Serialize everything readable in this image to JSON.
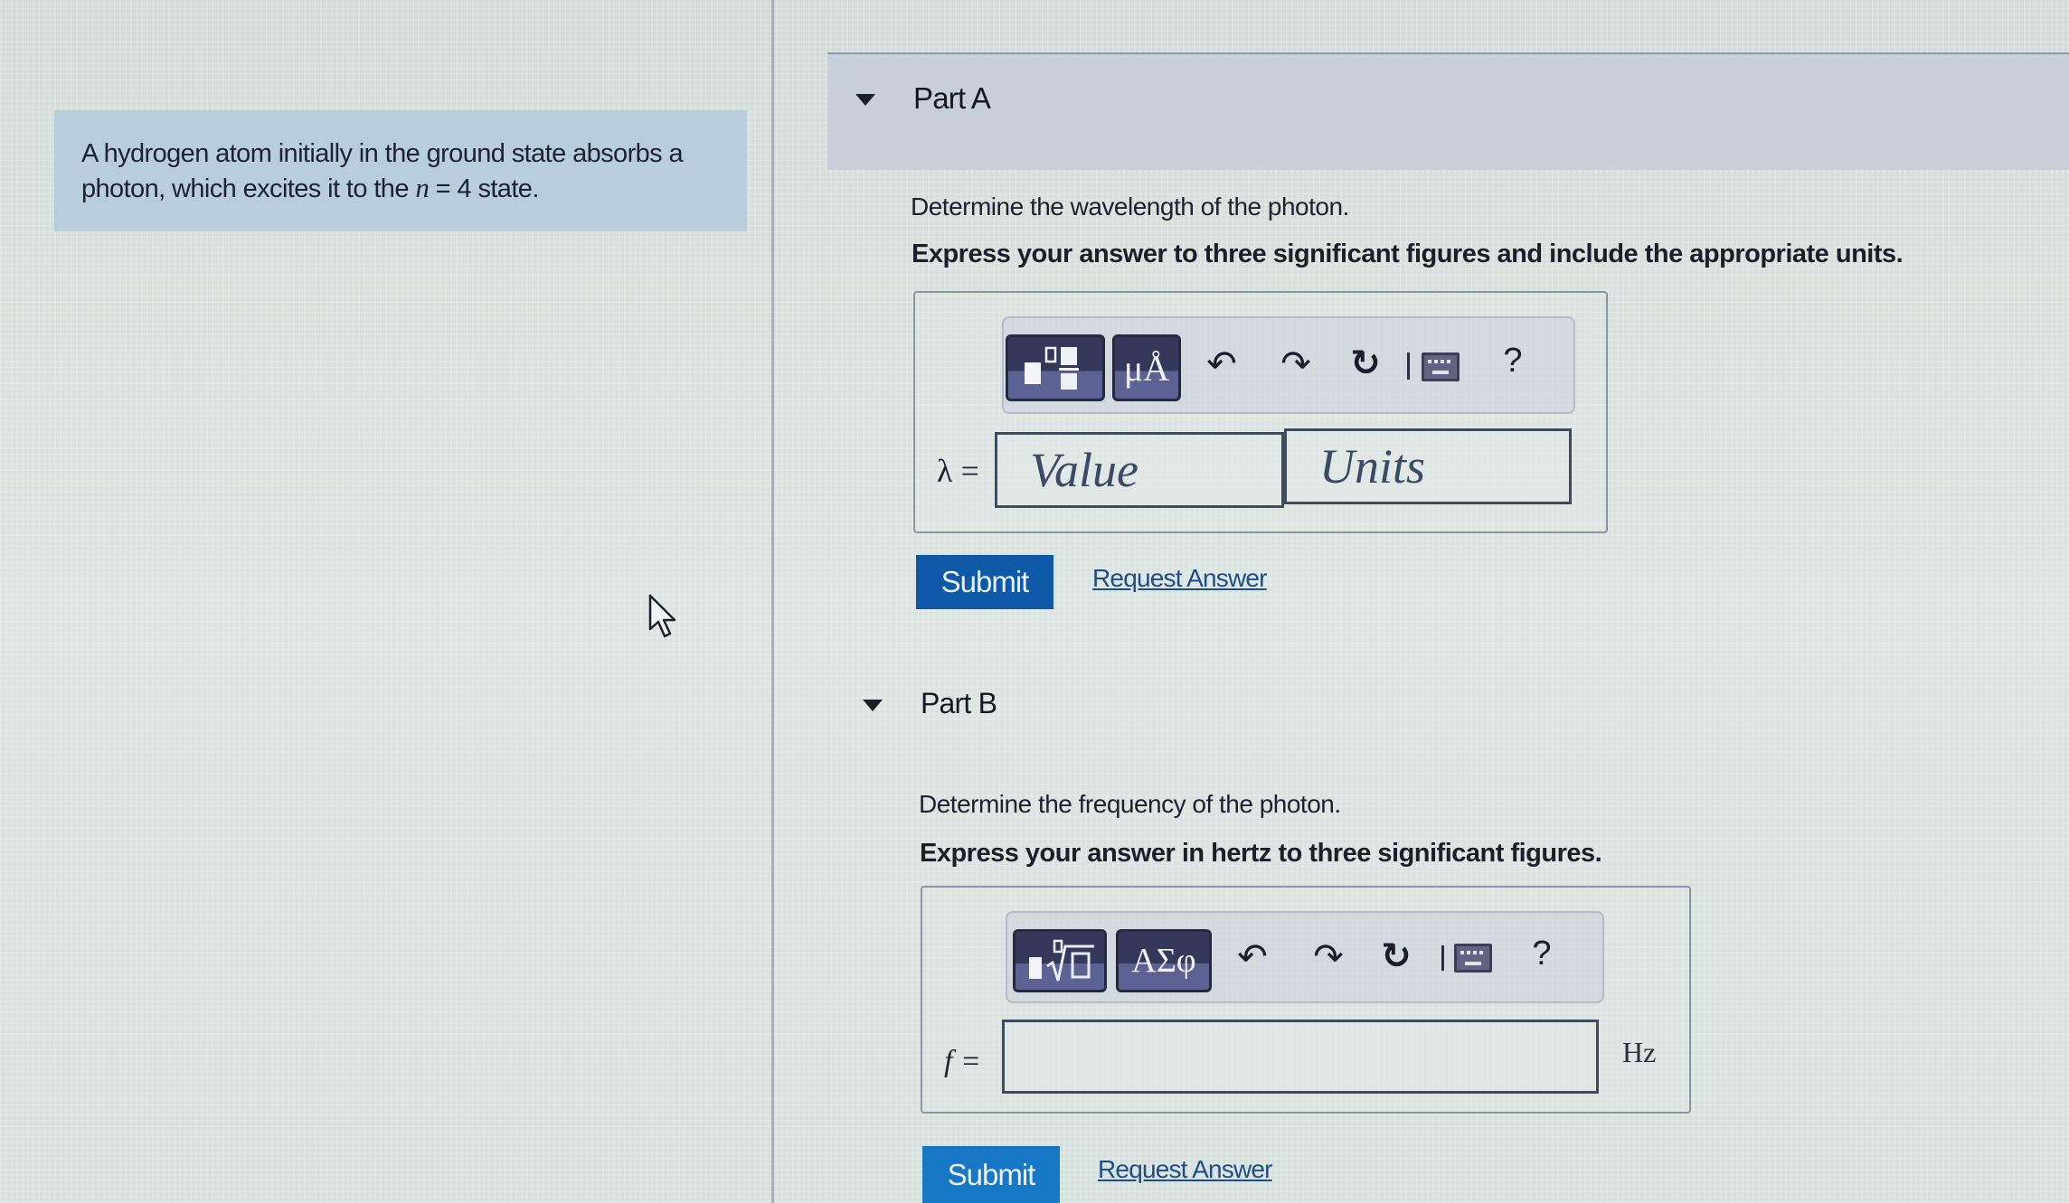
{
  "problem": {
    "text_before": "A hydrogen atom initially in the ground state absorbs a photon, which excites it to the ",
    "var": "n",
    "text_after": " = 4 state."
  },
  "part_a": {
    "title": "Part A",
    "prompt": "Determine the wavelength of the photon.",
    "instruction": "Express your answer to three significant figures and include the appropriate units.",
    "toolbar": {
      "templates_icon": "fraction-template-icon",
      "units_label": "μÅ",
      "undo_icon": "↶",
      "redo_icon": "↷",
      "reset_icon": "↻",
      "keyboard_icon": "keyboard-icon",
      "help_label": "?"
    },
    "variable_label": "λ =",
    "value_placeholder": "Value",
    "units_placeholder": "Units",
    "submit_label": "Submit",
    "request_answer_label": "Request Answer"
  },
  "part_b": {
    "title": "Part B",
    "prompt": "Determine the frequency of the photon.",
    "instruction": "Express your answer in hertz to three significant figures.",
    "toolbar": {
      "templates_icon": "radical-template-icon",
      "symbols_label": "ΑΣφ",
      "undo_icon": "↶",
      "redo_icon": "↷",
      "reset_icon": "↻",
      "keyboard_icon": "keyboard-icon",
      "help_label": "?"
    },
    "variable_label": "f =",
    "value": "",
    "unit": "Hz",
    "submit_label": "Submit",
    "request_answer_label": "Request Answer"
  },
  "colors": {
    "submit_a": "#0e5aa8",
    "submit_b": "#1677c4",
    "problem_box": "#b8cfdb",
    "header_band": "#c7cfdb",
    "link": "#1e4d87"
  }
}
